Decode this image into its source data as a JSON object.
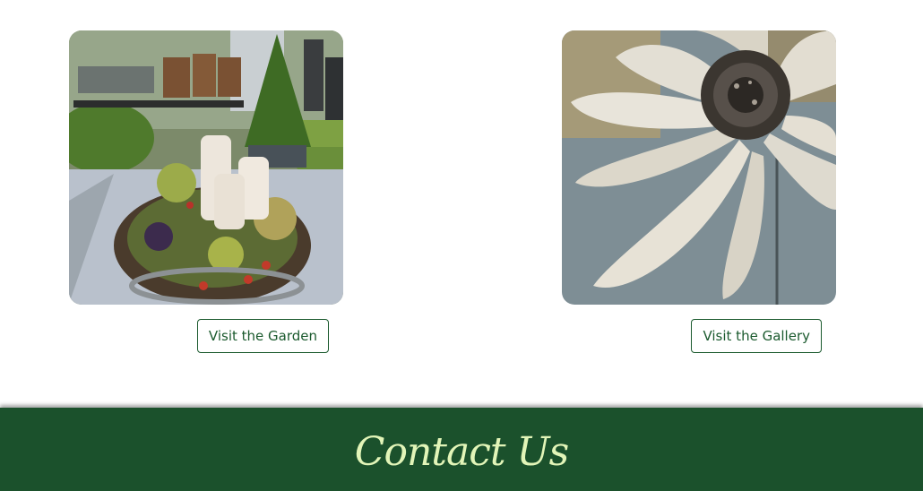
{
  "cards": [
    {
      "image_alt": "Table centerpiece with candles and hydrangeas in a garden",
      "button_label": "Visit the Garden"
    },
    {
      "image_alt": "Painting of a large white flower",
      "button_label": "Visit the Gallery"
    }
  ],
  "contact": {
    "title": "Contact Us"
  },
  "colors": {
    "brand_green": "#1b512c",
    "button_border": "#1b5a2e",
    "contact_title": "#e2f5b8"
  }
}
